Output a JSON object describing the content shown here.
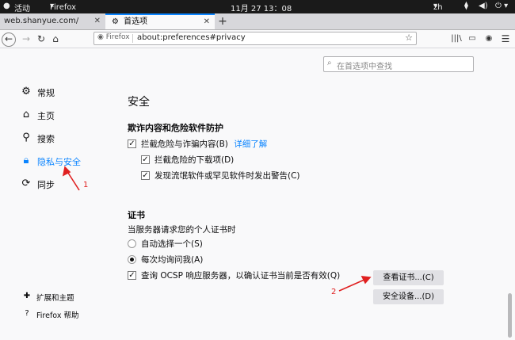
{
  "topbar": {
    "activities": "活动",
    "app": "Firefox",
    "datetime": "11月 27  13：08",
    "lang": "zh"
  },
  "tabs": [
    {
      "label": "web.shanyue.com/"
    },
    {
      "label": "首选项"
    }
  ],
  "urlbar": {
    "identity": "Firefox",
    "url": "about:preferences#privacy"
  },
  "search": {
    "placeholder": "在首选项中查找"
  },
  "sidebar": {
    "items": [
      {
        "label": "常规",
        "icon": "gear-icon"
      },
      {
        "label": "主页",
        "icon": "home-icon"
      },
      {
        "label": "搜索",
        "icon": "search-icon"
      },
      {
        "label": "隐私与安全",
        "icon": "lock-icon",
        "active": true
      },
      {
        "label": "同步",
        "icon": "sync-icon"
      }
    ],
    "footer": [
      {
        "label": "扩展和主题",
        "icon": "puzzle-icon"
      },
      {
        "label": "Firefox 帮助",
        "icon": "help-icon"
      }
    ]
  },
  "main": {
    "section_title": "安全",
    "deceptive": {
      "heading": "欺诈内容和危险软件防护",
      "block_label": "拦截危险与诈骗内容(B)",
      "learn_more": "详细了解",
      "block_downloads": "拦截危险的下载项(D)",
      "warn_unwanted": "发现流氓软件或罕见软件时发出警告(C)"
    },
    "certificates": {
      "heading": "证书",
      "desc": "当服务器请求您的个人证书时",
      "auto_select": "自动选择一个(S)",
      "ask_every": "每次均询问我(A)",
      "ocsp": "查询 OCSP 响应服务器，以确认证书当前是否有效(Q)",
      "view_button": "查看证书...(C)",
      "devices_button": "安全设备...(D)"
    }
  },
  "annotations": {
    "one": "1",
    "two": "2",
    "color": "#e02020"
  }
}
